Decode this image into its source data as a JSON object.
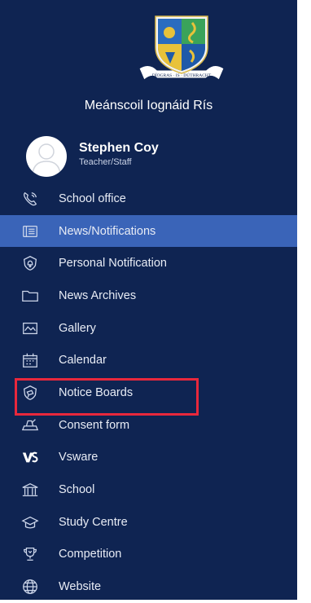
{
  "drawer": {
    "school_name": "Meánscoil Iognáid Rís",
    "crest_motto": "DÍOGRAS · IS · DÚTHRACHT"
  },
  "profile": {
    "name": "Stephen Coy",
    "role": "Teacher/Staff"
  },
  "menu": {
    "items": [
      {
        "label": "School office",
        "icon": "phone-icon"
      },
      {
        "label": "News/Notifications",
        "icon": "newspaper-icon",
        "active": true
      },
      {
        "label": "Personal Notification",
        "icon": "bell-shield-icon"
      },
      {
        "label": "News Archives",
        "icon": "folder-icon"
      },
      {
        "label": "Gallery",
        "icon": "image-icon"
      },
      {
        "label": "Calendar",
        "icon": "calendar-icon"
      },
      {
        "label": "Notice Boards",
        "icon": "notice-board-icon",
        "highlighted": true
      },
      {
        "label": "Consent form",
        "icon": "consent-form-icon"
      },
      {
        "label": "Vsware",
        "icon": "vsware-logo-icon"
      },
      {
        "label": "School",
        "icon": "school-building-icon"
      },
      {
        "label": "Study Centre",
        "icon": "graduation-cap-icon"
      },
      {
        "label": "Competition",
        "icon": "trophy-icon"
      },
      {
        "label": "Website",
        "icon": "globe-icon"
      }
    ]
  },
  "colors": {
    "drawer_background": "#0f2452",
    "active_item": "#3a64b8",
    "highlight_border": "#e8283c"
  }
}
